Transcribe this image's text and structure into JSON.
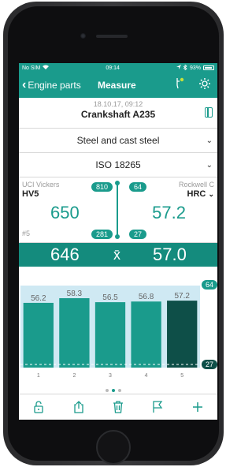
{
  "status": {
    "carrier": "No SIM",
    "time": "09:14",
    "battery": "93%"
  },
  "nav": {
    "back_label": "Engine parts",
    "title": "Measure"
  },
  "header": {
    "date": "18.10.17, 09:12",
    "name": "Crankshaft A235"
  },
  "material": {
    "selected": "Steel and cast steel"
  },
  "standard": {
    "selected": "ISO 18265"
  },
  "measure": {
    "left_label": "UCI Vickers",
    "left_scale": "HV5",
    "left_value": "650",
    "left_max": "810",
    "left_min": "281",
    "right_label": "Rockwell C",
    "right_scale": "HRC",
    "right_value": "57.2",
    "right_max": "64",
    "right_min": "27",
    "count": "#5"
  },
  "average": {
    "left": "646",
    "symbol": "x̄",
    "right": "57.0"
  },
  "chart_data": {
    "type": "bar",
    "categories": [
      "1",
      "2",
      "3",
      "4",
      "5"
    ],
    "values": [
      56.2,
      58.3,
      56.5,
      56.8,
      57.2
    ],
    "ylim": [
      27,
      64
    ],
    "upper_label": "64",
    "lower_label": "27",
    "bar_color": "#1a9b8c",
    "last_bar_color": "#0e4f48",
    "band_color": "#cfe9f3"
  },
  "colors": {
    "accent": "#1a9b8c"
  }
}
